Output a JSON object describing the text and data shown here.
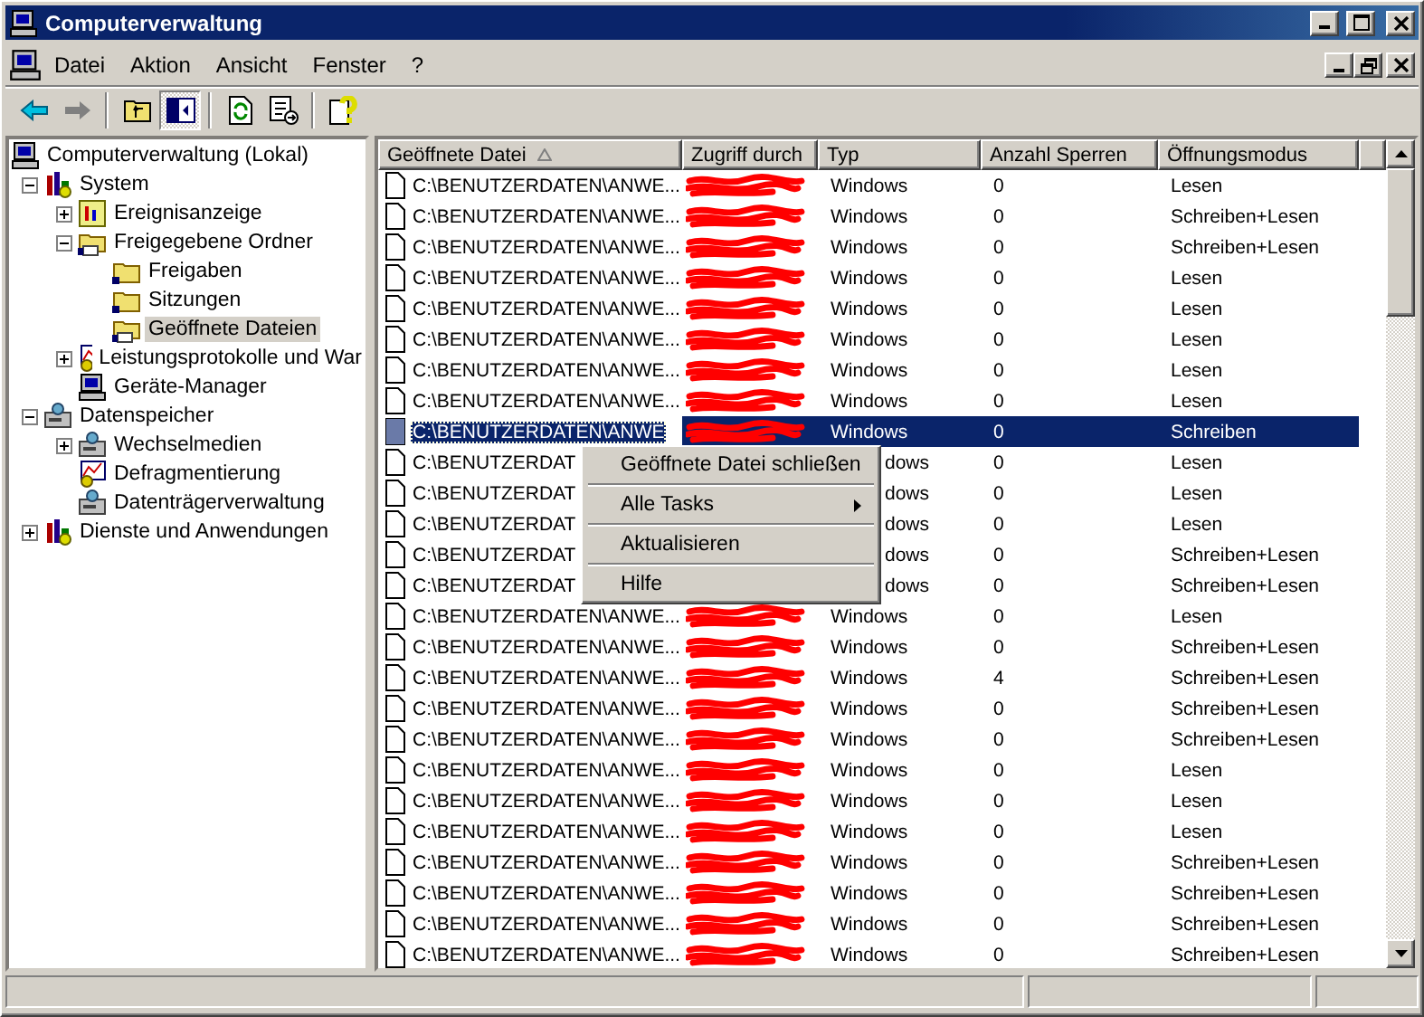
{
  "window": {
    "title": "Computerverwaltung"
  },
  "menu": [
    "Datei",
    "Aktion",
    "Ansicht",
    "Fenster",
    "?"
  ],
  "toolbar": [
    {
      "kind": "back",
      "disabled": false
    },
    {
      "kind": "forward",
      "disabled": true
    },
    {
      "kind": "separator"
    },
    {
      "kind": "up"
    },
    {
      "kind": "tree",
      "pressed": true
    },
    {
      "kind": "separator"
    },
    {
      "kind": "refresh"
    },
    {
      "kind": "export"
    },
    {
      "kind": "separator"
    },
    {
      "kind": "help"
    }
  ],
  "tree": [
    {
      "label": "Computerverwaltung (Lokal)",
      "kind": "computer",
      "selected": false,
      "children": [
        {
          "label": "System",
          "kind": "tools",
          "selected": false,
          "expanded": true,
          "children": [
            {
              "label": "Ereignisanzeige",
              "kind": "log",
              "selected": false,
              "expanded": false
            },
            {
              "label": "Freigegebene Ordner",
              "kind": "share",
              "selected": false,
              "expanded": true,
              "children": [
                {
                  "label": "Freigaben",
                  "kind": "folder",
                  "selected": false
                },
                {
                  "label": "Sitzungen",
                  "kind": "folder",
                  "selected": false
                },
                {
                  "label": "Geöffnete Dateien",
                  "kind": "share",
                  "selected": true
                }
              ]
            },
            {
              "label": "Leistungsprotokolle und War",
              "kind": "chart",
              "selected": false,
              "expanded": false
            },
            {
              "label": "Geräte-Manager",
              "kind": "computer",
              "selected": false
            }
          ]
        },
        {
          "label": "Datenspeicher",
          "kind": "drive",
          "selected": false,
          "expanded": true,
          "children": [
            {
              "label": "Wechselmedien",
              "kind": "drive",
              "selected": false,
              "expanded": false
            },
            {
              "label": "Defragmentierung",
              "kind": "chart",
              "selected": false
            },
            {
              "label": "Datenträgerverwaltung",
              "kind": "drive",
              "selected": false
            }
          ]
        },
        {
          "label": "Dienste und Anwendungen",
          "kind": "tools",
          "selected": false,
          "expanded": false
        }
      ]
    }
  ],
  "table": {
    "columns": [
      {
        "label": "Geöffnete Datei",
        "sorted": true
      },
      {
        "label": "Zugriff durch"
      },
      {
        "label": "Typ"
      },
      {
        "label": "Anzahl Sperren"
      },
      {
        "label": "Öffnungsmodus"
      }
    ],
    "rows": [
      {
        "file": "C:\\BENUTZERDATEN\\ANWE...",
        "type": "Windows",
        "locks": "0",
        "mode": "Lesen",
        "selected": false,
        "covered": false
      },
      {
        "file": "C:\\BENUTZERDATEN\\ANWE...",
        "type": "Windows",
        "locks": "0",
        "mode": "Schreiben+Lesen",
        "selected": false,
        "covered": false
      },
      {
        "file": "C:\\BENUTZERDATEN\\ANWE...",
        "type": "Windows",
        "locks": "0",
        "mode": "Schreiben+Lesen",
        "selected": false,
        "covered": false
      },
      {
        "file": "C:\\BENUTZERDATEN\\ANWE...",
        "type": "Windows",
        "locks": "0",
        "mode": "Lesen",
        "selected": false,
        "covered": false
      },
      {
        "file": "C:\\BENUTZERDATEN\\ANWE...",
        "type": "Windows",
        "locks": "0",
        "mode": "Lesen",
        "selected": false,
        "covered": false
      },
      {
        "file": "C:\\BENUTZERDATEN\\ANWE...",
        "type": "Windows",
        "locks": "0",
        "mode": "Lesen",
        "selected": false,
        "covered": false
      },
      {
        "file": "C:\\BENUTZERDATEN\\ANWE...",
        "type": "Windows",
        "locks": "0",
        "mode": "Lesen",
        "selected": false,
        "covered": false
      },
      {
        "file": "C:\\BENUTZERDATEN\\ANWE...",
        "type": "Windows",
        "locks": "0",
        "mode": "Lesen",
        "selected": false,
        "covered": false
      },
      {
        "file": "C:\\BENUTZERDATEN\\ANWE",
        "type": "Windows",
        "locks": "0",
        "mode": "Schreiben",
        "selected": true,
        "covered": false
      },
      {
        "file": "C:\\BENUTZERDAT",
        "type": "dows",
        "locks": "0",
        "mode": "Lesen",
        "selected": false,
        "covered": true
      },
      {
        "file": "C:\\BENUTZERDAT",
        "type": "dows",
        "locks": "0",
        "mode": "Lesen",
        "selected": false,
        "covered": true
      },
      {
        "file": "C:\\BENUTZERDAT",
        "type": "dows",
        "locks": "0",
        "mode": "Lesen",
        "selected": false,
        "covered": true
      },
      {
        "file": "C:\\BENUTZERDAT",
        "type": "dows",
        "locks": "0",
        "mode": "Schreiben+Lesen",
        "selected": false,
        "covered": true
      },
      {
        "file": "C:\\BENUTZERDAT",
        "type": "dows",
        "locks": "0",
        "mode": "Schreiben+Lesen",
        "selected": false,
        "covered": true
      },
      {
        "file": "C:\\BENUTZERDATEN\\ANWE...",
        "type": "Windows",
        "locks": "0",
        "mode": "Lesen",
        "selected": false,
        "covered": false
      },
      {
        "file": "C:\\BENUTZERDATEN\\ANWE...",
        "type": "Windows",
        "locks": "0",
        "mode": "Schreiben+Lesen",
        "selected": false,
        "covered": false
      },
      {
        "file": "C:\\BENUTZERDATEN\\ANWE...",
        "type": "Windows",
        "locks": "4",
        "mode": "Schreiben+Lesen",
        "selected": false,
        "covered": false
      },
      {
        "file": "C:\\BENUTZERDATEN\\ANWE...",
        "type": "Windows",
        "locks": "0",
        "mode": "Schreiben+Lesen",
        "selected": false,
        "covered": false
      },
      {
        "file": "C:\\BENUTZERDATEN\\ANWE...",
        "type": "Windows",
        "locks": "0",
        "mode": "Schreiben+Lesen",
        "selected": false,
        "covered": false
      },
      {
        "file": "C:\\BENUTZERDATEN\\ANWE...",
        "type": "Windows",
        "locks": "0",
        "mode": "Lesen",
        "selected": false,
        "covered": false
      },
      {
        "file": "C:\\BENUTZERDATEN\\ANWE...",
        "type": "Windows",
        "locks": "0",
        "mode": "Lesen",
        "selected": false,
        "covered": false
      },
      {
        "file": "C:\\BENUTZERDATEN\\ANWE...",
        "type": "Windows",
        "locks": "0",
        "mode": "Lesen",
        "selected": false,
        "covered": false
      },
      {
        "file": "C:\\BENUTZERDATEN\\ANWE...",
        "type": "Windows",
        "locks": "0",
        "mode": "Schreiben+Lesen",
        "selected": false,
        "covered": false
      },
      {
        "file": "C:\\BENUTZERDATEN\\ANWE...",
        "type": "Windows",
        "locks": "0",
        "mode": "Schreiben+Lesen",
        "selected": false,
        "covered": false
      },
      {
        "file": "C:\\BENUTZERDATEN\\ANWE...",
        "type": "Windows",
        "locks": "0",
        "mode": "Schreiben+Lesen",
        "selected": false,
        "covered": false
      },
      {
        "file": "C:\\BENUTZERDATEN\\ANWE...",
        "type": "Windows",
        "locks": "0",
        "mode": "Schreiben+Lesen",
        "selected": false,
        "covered": false
      }
    ]
  },
  "context_menu": [
    {
      "kind": "item",
      "label": "Geöffnete Datei schließen"
    },
    {
      "kind": "separator"
    },
    {
      "kind": "submenu",
      "label": "Alle Tasks"
    },
    {
      "kind": "separator"
    },
    {
      "kind": "item",
      "label": "Aktualisieren"
    },
    {
      "kind": "separator"
    },
    {
      "kind": "item",
      "label": "Hilfe"
    }
  ]
}
